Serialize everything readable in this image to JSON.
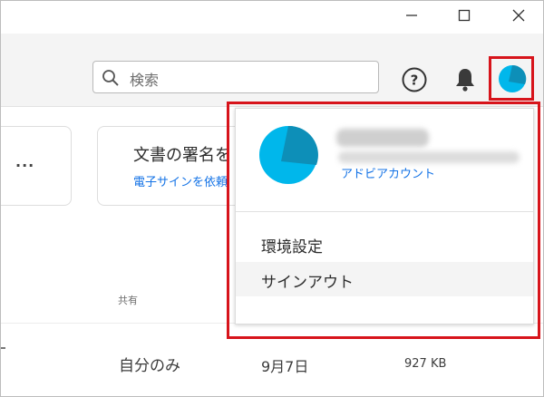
{
  "toolbar": {
    "search_placeholder": "検索"
  },
  "cards": {
    "more_label": "...",
    "sign_title": "文書の署名を",
    "sign_subtitle": "電子サインを依頼"
  },
  "table": {
    "share_header": "共有",
    "row": {
      "sharing": "自分のみ",
      "date": "9月7日",
      "size": "927 KB"
    }
  },
  "account_menu": {
    "account_link": "アドビアカウント",
    "preferences": "環境設定",
    "sign_out": "サインアウト"
  },
  "colors": {
    "highlight": "#d7141b",
    "avatar": "#00b7eb",
    "link": "#1473e6"
  },
  "icons": [
    "minimize-icon",
    "maximize-icon",
    "close-icon",
    "search-icon",
    "help-icon",
    "bell-icon",
    "avatar-icon"
  ]
}
